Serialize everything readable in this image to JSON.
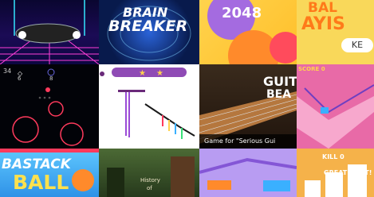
{
  "tiles": {
    "brain_breaker": {
      "title": "BRAIN",
      "title2": "BREAKER"
    },
    "g2048": {
      "title": "2048"
    },
    "balls": {
      "title": "BAL",
      "title2": "AYIS",
      "title3": "KE"
    },
    "ring": {
      "score": "34",
      "mid": "8",
      "left": "6"
    },
    "guitar": {
      "title": "GUIT",
      "title2": "BEA",
      "tag": "Game for \"Serious Gui"
    },
    "slope": {
      "score": "SCORE 0"
    },
    "bastack": {
      "title": "BASTACK",
      "title2": "BALL"
    },
    "history": {
      "line1": "History",
      "line2": "of"
    },
    "kill": {
      "title": "KILL 0",
      "title2": "GREAT SHOT!"
    }
  },
  "colors": {
    "accent": "#ffd34d",
    "pink": "#e86aa7"
  }
}
